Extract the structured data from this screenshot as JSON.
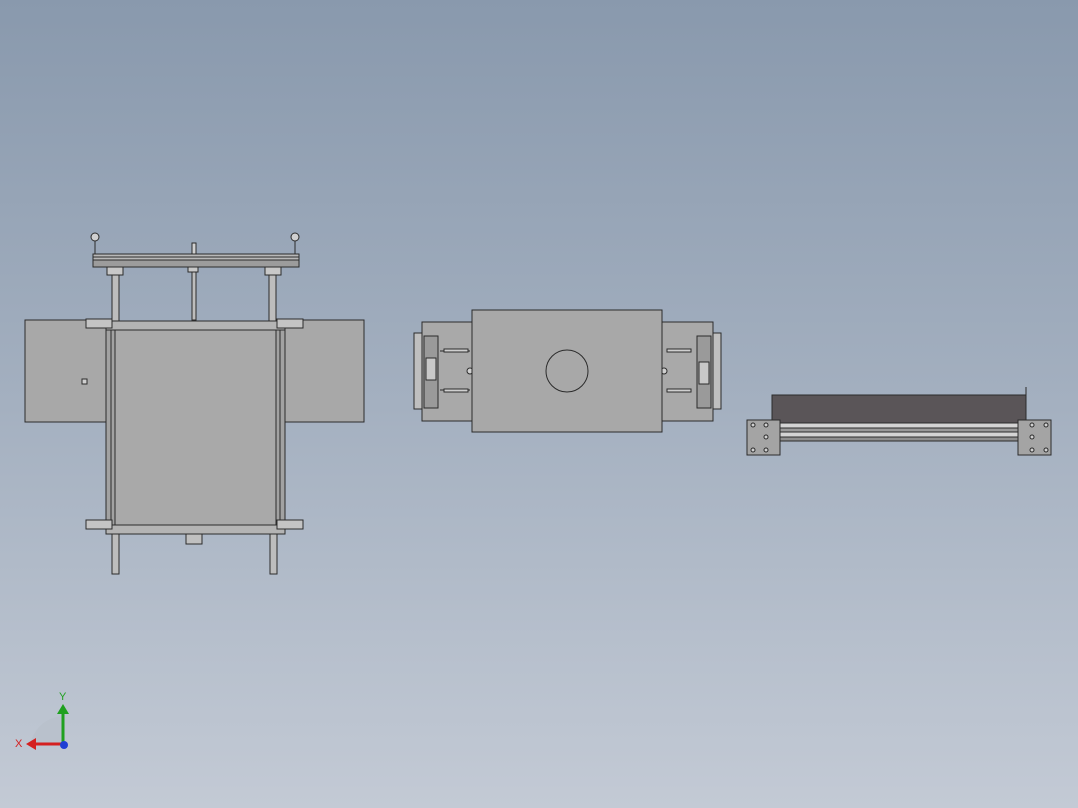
{
  "viewport": {
    "background_top": "#8999ad",
    "background_bottom": "#c3cad5"
  },
  "part_colors": {
    "body": "#a6a6a6",
    "edge": "#2b2b2b",
    "dark_panel": "#5a5558",
    "light": "#d0d0d0"
  },
  "triad": {
    "x_label": "X",
    "y_label": "Y",
    "x_color": "#d42020",
    "y_color": "#1fa01f",
    "z_color": "#1f3fd4"
  }
}
